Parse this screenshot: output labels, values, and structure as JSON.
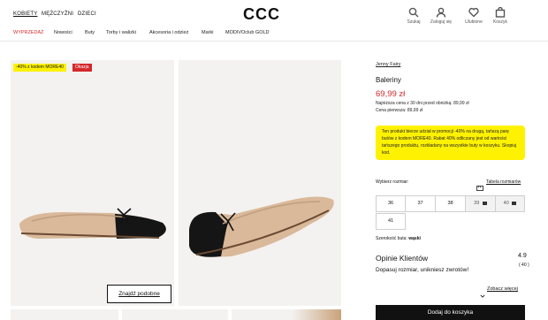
{
  "header": {
    "gender_tabs": [
      "KOBIETY",
      "MĘŻCZYŹNI",
      "DZIECI"
    ],
    "logo": "CCC",
    "icons": [
      {
        "icon": "search-icon",
        "label": "Szukaj"
      },
      {
        "icon": "user-icon",
        "label": "Zaloguj się"
      },
      {
        "icon": "heart-icon",
        "label": "Ulubione"
      },
      {
        "icon": "bag-icon",
        "label": "Koszyk"
      }
    ]
  },
  "nav": [
    "WYPRZEDAŻ",
    "Nowości",
    "Buty",
    "Torby i walizki",
    "Akcesoria i odzież",
    "Marki",
    "MODIVOclub GOLD"
  ],
  "colors": {
    "accent_red": "#d4282b",
    "promo_yellow": "#fff200",
    "badge_red": "#d4282b"
  },
  "gallery": {
    "badge_promo": "-40% z kodem MORE40",
    "badge_deal": "Okazja",
    "similar_button": "Znajdź podobne"
  },
  "product": {
    "brand": "Jenny Fairy",
    "name": "Baleriny",
    "price": "69,99 zł",
    "lowest_price": "Najniższa cena z 30 dni przed obniżką: 89,99 zł",
    "first_price": "Cena pierwsza: 89,99 zł",
    "promo_text": "Ten produkt bierze udział w promocji -40% na drugą, tańszą parę butów z kodem MORE40. Rabat 40% odliczany jest od wartości tańszego produktu, rozkładany na wszystkie buty w koszyku. Skopiuj kod.",
    "size_label": "Wybierz rozmiar:",
    "size_table": "Tabela rozmiarów",
    "sizes": [
      "36",
      "37",
      "38",
      "39",
      "40",
      "41"
    ],
    "width_label": "Szerokość buta:",
    "width_value": "wąski",
    "reviews_title": "Opinie Klientów",
    "rating": "4.9",
    "reviews_count": "( 40 )",
    "reviews_sub": "Dopasuj rozmiar, unikniesz zwrotów!",
    "see_all": "Zobacz więcej",
    "add_to_cart": "Dodaj do koszyka"
  }
}
